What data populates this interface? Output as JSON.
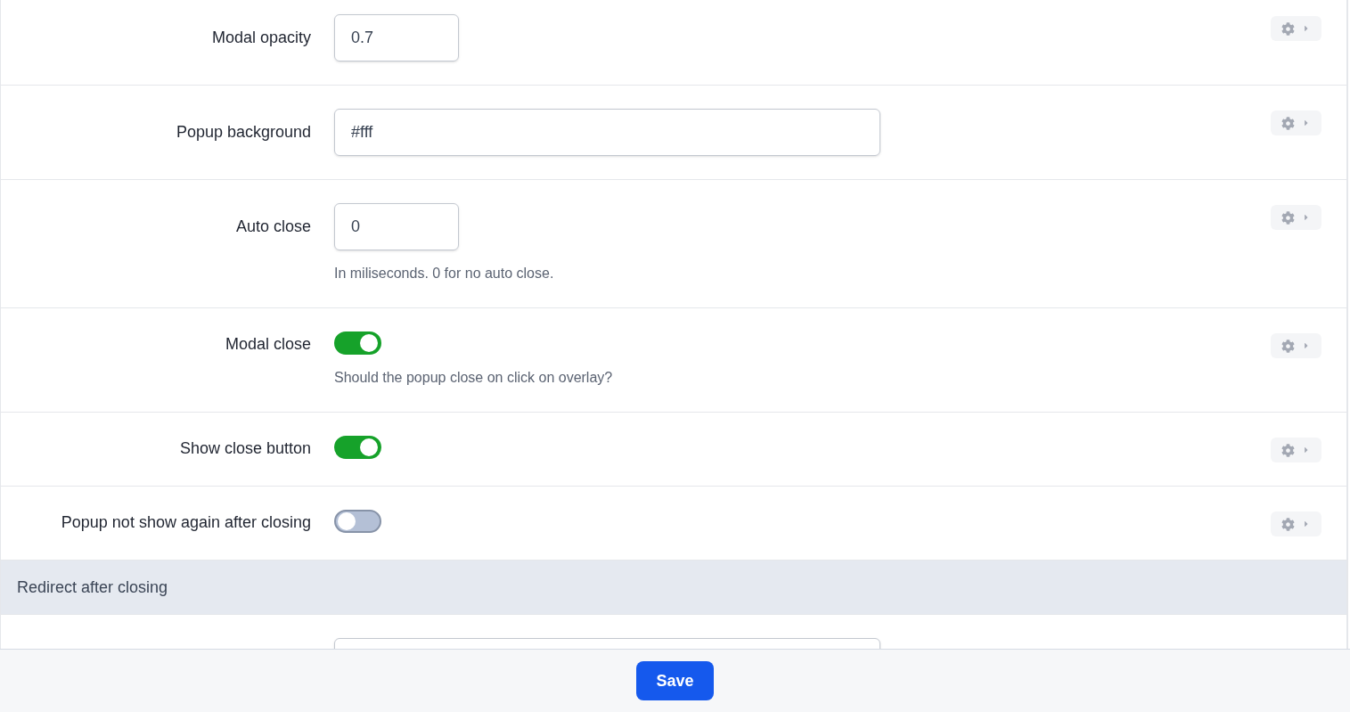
{
  "settings": [
    {
      "kind": "number",
      "label": "Modal opacity",
      "value": "0.7",
      "menu": true
    },
    {
      "kind": "text",
      "label": "Popup background",
      "value": "#fff",
      "menu": true
    },
    {
      "kind": "number",
      "label": "Auto close",
      "value": "0",
      "help": "In miliseconds. 0 for no auto close.",
      "menu": true
    },
    {
      "kind": "toggle",
      "label": "Modal close",
      "on": true,
      "help": "Should the popup close on click on overlay?",
      "menu": true
    },
    {
      "kind": "toggle",
      "label": "Show close button",
      "on": true,
      "menu": true
    },
    {
      "kind": "toggle",
      "label": "Popup not show again after closing",
      "on": false,
      "menu": true
    },
    {
      "kind": "section",
      "label": "Redirect after closing"
    },
    {
      "kind": "text",
      "menu": false
    }
  ],
  "footer": {
    "save": "Save"
  }
}
